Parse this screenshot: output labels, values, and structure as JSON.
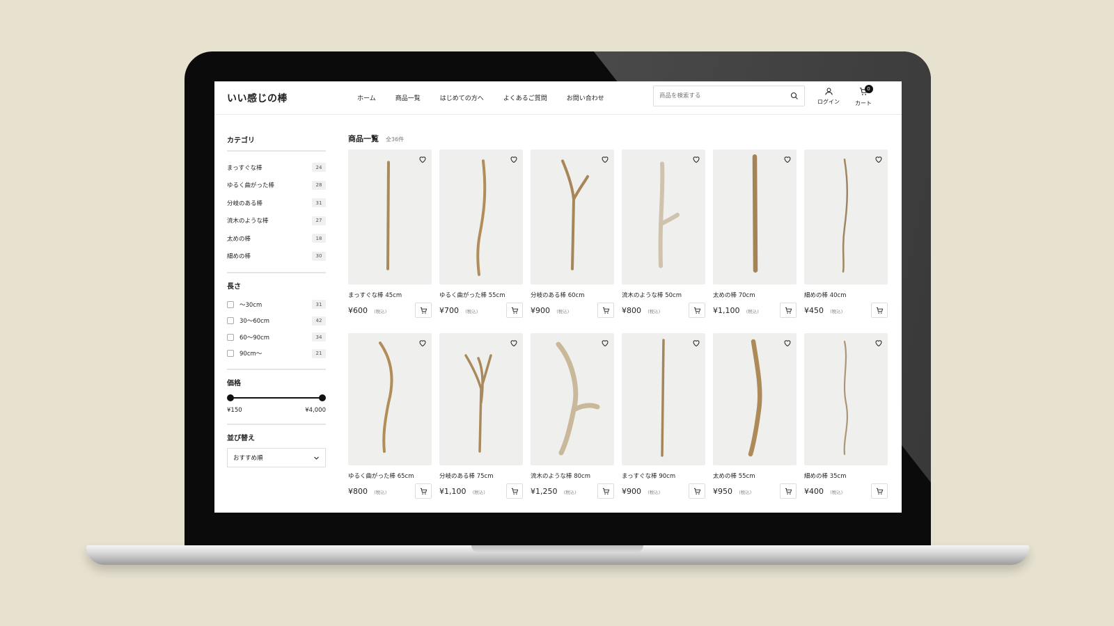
{
  "header": {
    "logo": "いい感じの棒",
    "nav": [
      "ホーム",
      "商品一覧",
      "はじめての方へ",
      "よくあるご質問",
      "お問い合わせ"
    ],
    "search_placeholder": "商品を検索する",
    "login_label": "ログイン",
    "cart_label": "カート",
    "cart_count": "0"
  },
  "sidebar": {
    "category_title": "カテゴリ",
    "categories": [
      {
        "label": "まっすぐな棒",
        "count": "24"
      },
      {
        "label": "ゆるく曲がった棒",
        "count": "28"
      },
      {
        "label": "分岐のある棒",
        "count": "31"
      },
      {
        "label": "流木のような棒",
        "count": "27"
      },
      {
        "label": "太めの棒",
        "count": "18"
      },
      {
        "label": "細めの棒",
        "count": "30"
      }
    ],
    "length_title": "長さ",
    "lengths": [
      {
        "label": "〜30cm",
        "count": "31"
      },
      {
        "label": "30〜60cm",
        "count": "42"
      },
      {
        "label": "60〜90cm",
        "count": "34"
      },
      {
        "label": "90cm〜",
        "count": "21"
      }
    ],
    "price_title": "価格",
    "price_min": "¥150",
    "price_max": "¥4,000",
    "sort_title": "並び替え",
    "sort_value": "おすすめ順"
  },
  "main": {
    "title": "商品一覧",
    "count": "全36件",
    "tax_label": "(税込)",
    "products": [
      {
        "name": "まっすぐな棒 45cm",
        "price": "¥600"
      },
      {
        "name": "ゆるく曲がった棒 55cm",
        "price": "¥700"
      },
      {
        "name": "分岐のある棒 60cm",
        "price": "¥900"
      },
      {
        "name": "流木のような棒 50cm",
        "price": "¥800"
      },
      {
        "name": "太めの棒 70cm",
        "price": "¥1,100"
      },
      {
        "name": "細めの棒 40cm",
        "price": "¥450"
      },
      {
        "name": "ゆるく曲がった棒 65cm",
        "price": "¥800"
      },
      {
        "name": "分岐のある棒 75cm",
        "price": "¥1,100"
      },
      {
        "name": "流木のような棒 80cm",
        "price": "¥1,250"
      },
      {
        "name": "まっすぐな棒 90cm",
        "price": "¥900"
      },
      {
        "name": "太めの棒 55cm",
        "price": "¥950"
      },
      {
        "name": "細めの棒 35cm",
        "price": "¥400"
      }
    ]
  },
  "colors": {
    "background": "#e7e1cf",
    "stick": "#a98a5c",
    "stick_light": "#cfc3ae",
    "accent": "#111111"
  }
}
